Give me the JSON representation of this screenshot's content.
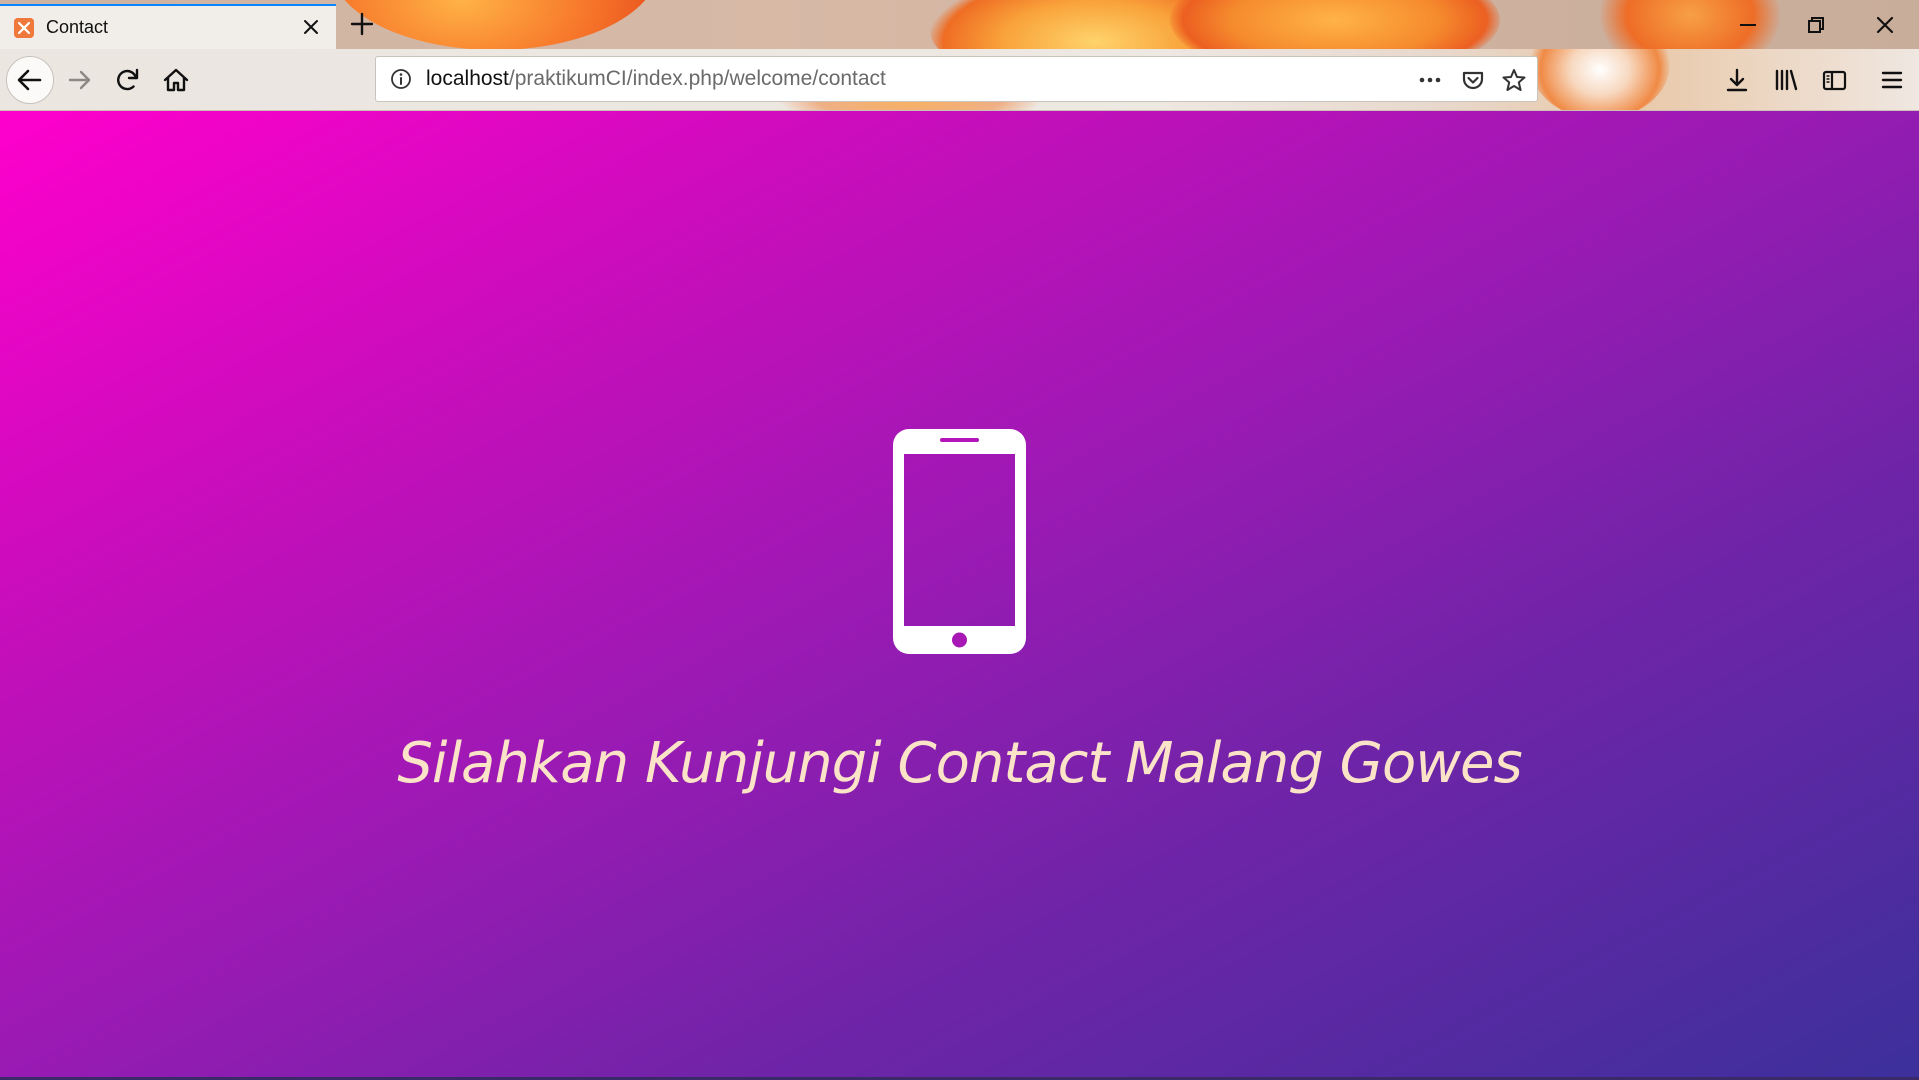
{
  "tab": {
    "title": "Contact",
    "favicon_letter": "⌘"
  },
  "urlbar": {
    "host": "localhost",
    "path": "/praktikumCI/index.php/welcome/contact"
  },
  "page": {
    "icon": "mobile-phone-icon",
    "headline": "Silahkan Kunjungi Contact Malang Gowes"
  },
  "colors": {
    "gradient_start": "#ff00cc",
    "gradient_end": "#3c309b",
    "headline_text": "#fbe3c8",
    "icon": "#ffffff"
  }
}
